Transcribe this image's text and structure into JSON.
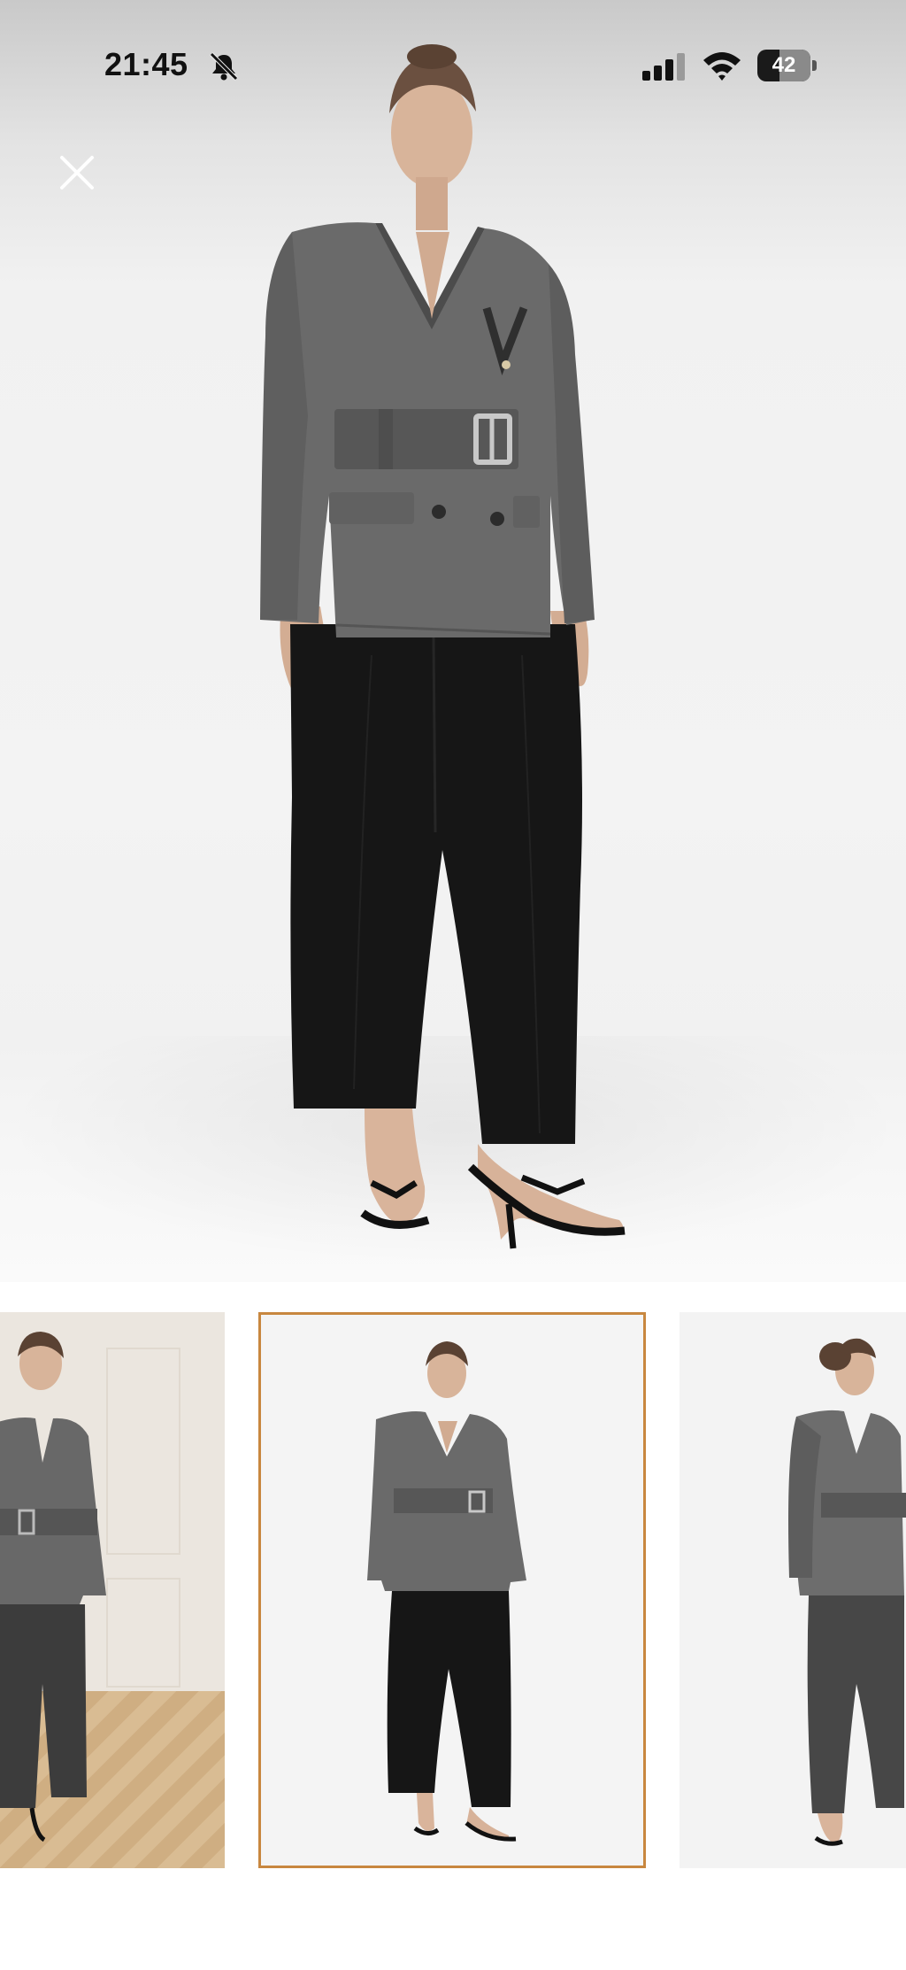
{
  "status_bar": {
    "time": "21:45",
    "silent_icon": "bell-slash-icon",
    "signal_icon": "cellular-signal-icon",
    "wifi_icon": "wifi-icon",
    "battery_level": "42",
    "battery_fraction": 0.42
  },
  "viewer": {
    "close_icon": "close-icon"
  },
  "thumbnails": [
    {
      "name": "thumbnail-lifestyle-room",
      "selected": false
    },
    {
      "name": "thumbnail-front-view",
      "selected": true
    },
    {
      "name": "thumbnail-side-view",
      "selected": false
    }
  ],
  "colors": {
    "selected_border": "#c8873f",
    "jacket_grey": "#6a6a6a",
    "trousers_black": "#161616"
  }
}
